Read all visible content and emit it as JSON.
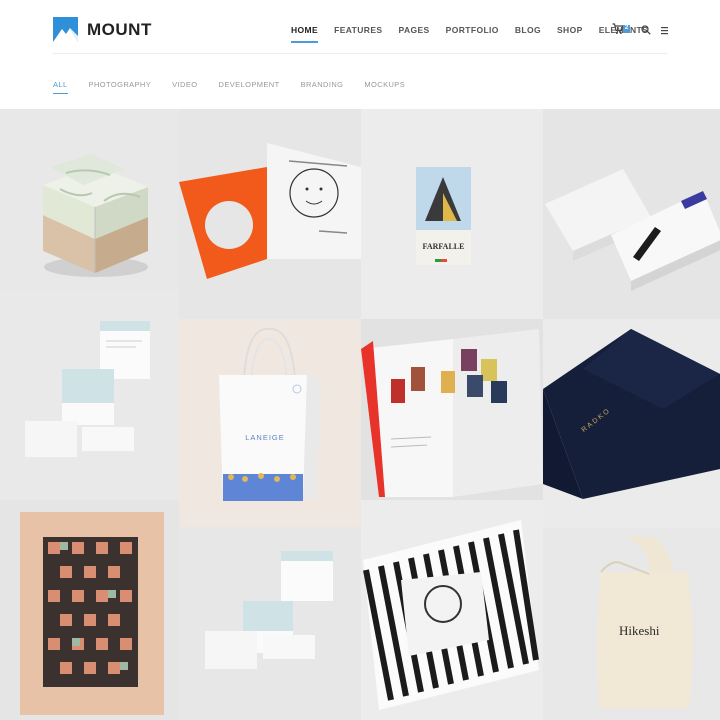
{
  "brand": {
    "name": "MOUNT",
    "accent": "#2f8fd9"
  },
  "nav": {
    "items": [
      "HOME",
      "FEATURES",
      "PAGES",
      "PORTFOLIO",
      "BLOG",
      "SHOP",
      "ELEMENTS"
    ],
    "cart_count": "2"
  },
  "filters": [
    "ALL",
    "PHOTOGRAPHY",
    "VIDEO",
    "DEVELOPMENT",
    "BRANDING",
    "MOCKUPS"
  ],
  "portfolio": [
    {
      "title": "Map cube"
    },
    {
      "title": "Orange folder"
    },
    {
      "title": "Farfalle poster",
      "text": "FARFALLE"
    },
    {
      "title": "Business cards"
    },
    {
      "title": "Envelopes"
    },
    {
      "title": "Laneige bag",
      "text": "LANEIGE"
    },
    {
      "title": "Chairs magazine"
    },
    {
      "title": "Navy folder",
      "text": "RADKO"
    },
    {
      "title": "Pattern poster"
    },
    {
      "title": "Envelopes 2"
    },
    {
      "title": "Striped book"
    },
    {
      "title": "Hikeshi tote",
      "text": "Hikeshi"
    }
  ]
}
